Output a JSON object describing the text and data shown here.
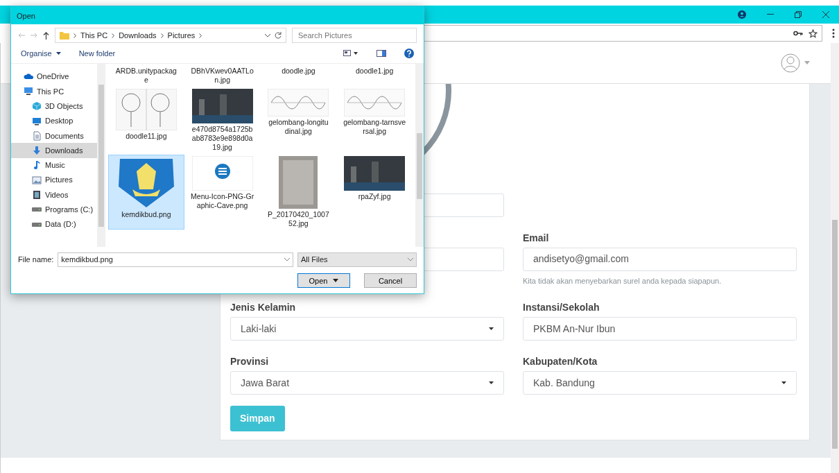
{
  "dialog": {
    "title": "Open",
    "breadcrumbs": [
      "This PC",
      "Downloads",
      "Pictures"
    ],
    "search": {
      "placeholder": "Search Pictures"
    },
    "toolbar": [
      {
        "label": "Organise",
        "kind": "menu"
      },
      {
        "label": "New folder",
        "kind": "plain"
      }
    ],
    "nav": [
      {
        "label": "OneDrive",
        "kind": "cloud",
        "selected": false
      },
      {
        "label": "This PC",
        "kind": "computer",
        "selected": false,
        "children": [
          {
            "label": "3D Objects",
            "kind": "cube",
            "selected": false
          },
          {
            "label": "Desktop",
            "kind": "desktop",
            "selected": false
          },
          {
            "label": "Documents",
            "kind": "document",
            "selected": false
          },
          {
            "label": "Downloads",
            "kind": "download",
            "selected": true
          },
          {
            "label": "Music",
            "kind": "music",
            "selected": false
          },
          {
            "label": "Pictures",
            "kind": "picture",
            "selected": false
          },
          {
            "label": "Videos",
            "kind": "video",
            "selected": false
          },
          {
            "label": "Programs (C:)",
            "kind": "drive",
            "selected": false
          },
          {
            "label": "Data (D:)",
            "kind": "drive",
            "selected": false
          }
        ]
      }
    ],
    "files": [
      {
        "name": "ARDB.unitypackage",
        "kind": "none",
        "selected": false
      },
      {
        "name": "DBhVKwev0AATLon.jpg",
        "kind": "none",
        "selected": false
      },
      {
        "name": "doodle.jpg",
        "kind": "none",
        "selected": false
      },
      {
        "name": "doodle1.jpg",
        "kind": "none",
        "selected": false
      },
      {
        "name": "doodle11.jpg",
        "kind": "sketch",
        "selected": false
      },
      {
        "name": "e470d8754a1725bab8783e9e898d0a19.jpg",
        "kind": "photo",
        "selected": false
      },
      {
        "name": "gelombang-longitudinal.jpg",
        "kind": "diagram",
        "selected": false
      },
      {
        "name": "gelombang-tarnsversal.jpg",
        "kind": "diagram",
        "selected": false
      },
      {
        "name": "kemdikbud.png",
        "kind": "logo",
        "selected": true
      },
      {
        "name": "Menu-Icon-PNG-Graphic-Cave.png",
        "kind": "menu",
        "selected": false
      },
      {
        "name": "P_20170420_100752.jpg",
        "kind": "paper",
        "selected": false
      },
      {
        "name": "rpaZyf.jpg",
        "kind": "photo",
        "selected": false
      }
    ],
    "file_name_label": "File name:",
    "file_name": "kemdikbud.png",
    "file_type": "All Files",
    "buttons": [
      {
        "label": "Open",
        "kind": "split"
      },
      {
        "label": "Cancel",
        "kind": "plain"
      }
    ]
  },
  "form": {
    "rows": [
      {
        "fields": [
          {
            "kind": "text"
          }
        ]
      },
      {
        "fields": [
          {
            "kind": "text"
          },
          {
            "kind": "text",
            "label": "Email",
            "value": "andisetyo@gmail.com",
            "help": "Kita tidak akan menyebarkan surel anda kepada siapapun."
          }
        ]
      },
      {
        "fields": [
          {
            "kind": "select",
            "label": "Jenis Kelamin",
            "value": "Laki-laki"
          },
          {
            "kind": "text",
            "label": "Instansi/Sekolah",
            "value": "PKBM An-Nur Ibun"
          }
        ]
      },
      {
        "fields": [
          {
            "kind": "select",
            "label": "Provinsi",
            "value": "Jawa Barat"
          },
          {
            "kind": "select",
            "label": "Kabupaten/Kota",
            "value": "Kab. Bandung"
          }
        ]
      }
    ],
    "submit": "Simpan"
  }
}
